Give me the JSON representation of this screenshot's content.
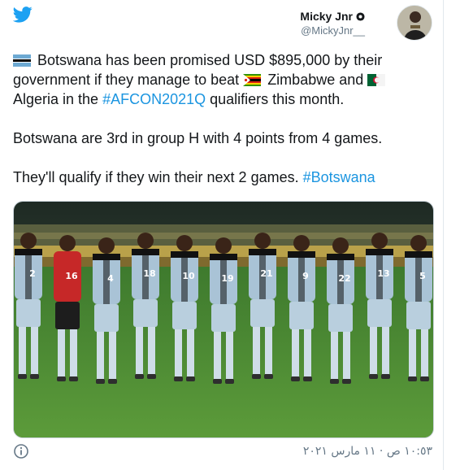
{
  "author": {
    "name": "Micky Jnr",
    "handle": "@MickyJnr__"
  },
  "tweet": {
    "line1_a": " Botswana has been promised USD $895,000 by their government if they manage to beat ",
    "line1_b": " Zimbabwe and ",
    "line1_c": " Algeria in the ",
    "hashtag1": "#AFCON2021Q",
    "line1_d": " qualifiers this month.",
    "para2": "Botswana are 3rd in group H with 4 points from 4 games.",
    "para3": "They'll qualify if they win their next 2 games. ",
    "hashtag2": "#Botswana"
  },
  "media": {
    "jersey_numbers": [
      "2",
      "16",
      "4",
      "18",
      "10",
      "19",
      "21",
      "9",
      "22",
      "13",
      "5"
    ]
  },
  "footer": {
    "timestamp": "١٠:٥٣ ص · ١١ مارس ٢٠٢١"
  },
  "icons": {
    "twitter": "twitter-bird-icon",
    "info": "info-icon",
    "verified_gear": "gear-icon",
    "flags": [
      "botswana-flag-icon",
      "zimbabwe-flag-icon",
      "algeria-flag-icon"
    ]
  },
  "colors": {
    "link": "#1b95e0",
    "twitter_blue": "#1da1f2",
    "muted": "#657786"
  }
}
